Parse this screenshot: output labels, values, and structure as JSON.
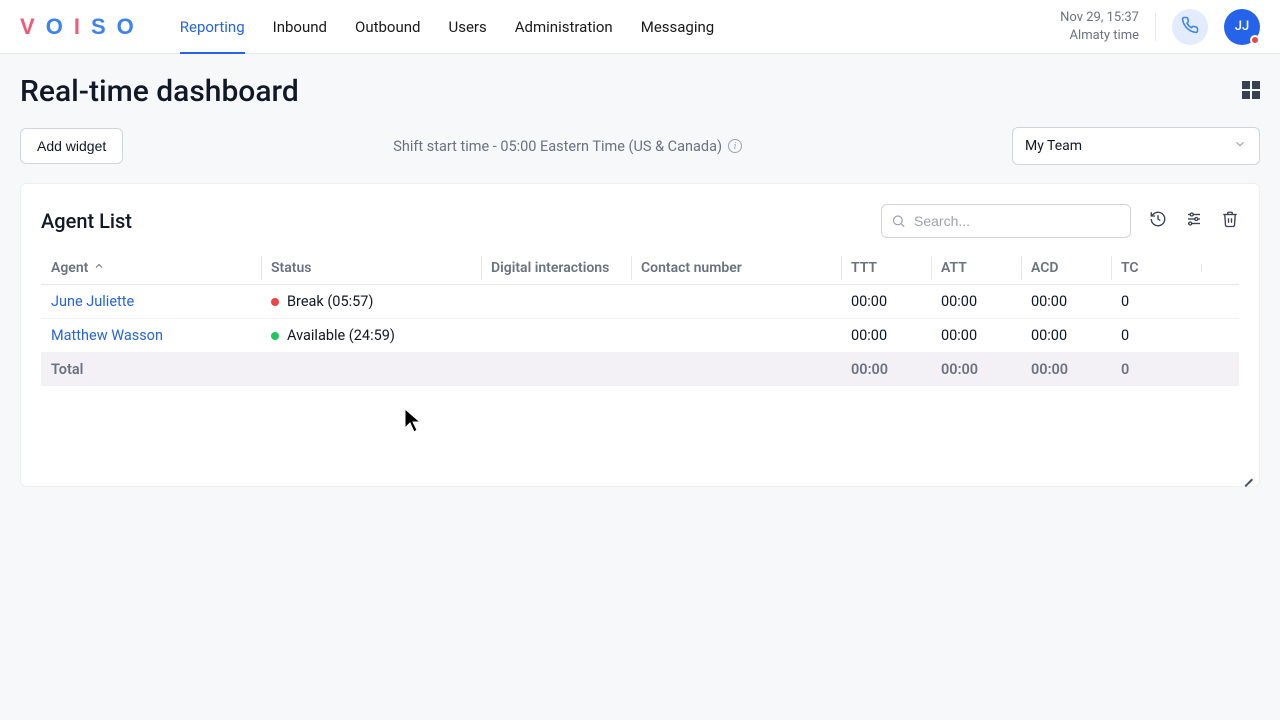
{
  "nav": {
    "items": [
      {
        "label": "Reporting",
        "active": true
      },
      {
        "label": "Inbound",
        "active": false
      },
      {
        "label": "Outbound",
        "active": false
      },
      {
        "label": "Users",
        "active": false
      },
      {
        "label": "Administration",
        "active": false
      },
      {
        "label": "Messaging",
        "active": false
      }
    ],
    "datetime_line1": "Nov 29, 15:37",
    "datetime_line2": "Almaty time",
    "avatar_initials": "JJ"
  },
  "page": {
    "title": "Real-time dashboard",
    "add_widget_label": "Add widget",
    "shift_text": "Shift start time - 05:00 Eastern Time (US & Canada)",
    "team_select_value": "My Team"
  },
  "widget": {
    "title": "Agent List",
    "search_placeholder": "Search...",
    "columns": {
      "agent": "Agent",
      "status": "Status",
      "digital": "Digital interactions",
      "contact": "Contact number",
      "ttt": "TTT",
      "att": "ATT",
      "acd": "ACD",
      "tc": "TC"
    },
    "rows": [
      {
        "agent": "June Juliette",
        "status_text": "Break (05:57)",
        "status_color": "red",
        "digital": "",
        "contact": "",
        "ttt": "00:00",
        "att": "00:00",
        "acd": "00:00",
        "tc": "0"
      },
      {
        "agent": "Matthew Wasson",
        "status_text": "Available (24:59)",
        "status_color": "green",
        "digital": "",
        "contact": "",
        "ttt": "00:00",
        "att": "00:00",
        "acd": "00:00",
        "tc": "0"
      }
    ],
    "total": {
      "label": "Total",
      "ttt": "00:00",
      "att": "00:00",
      "acd": "00:00",
      "tc": "0"
    }
  }
}
